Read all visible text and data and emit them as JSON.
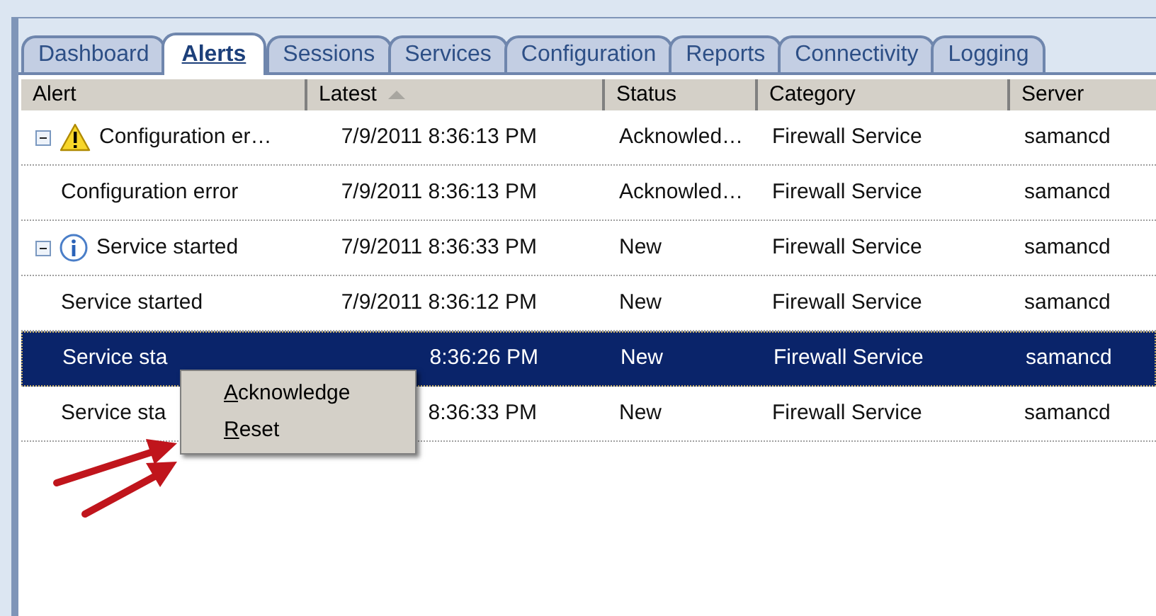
{
  "tabs": [
    {
      "label": "Dashboard",
      "selected": false
    },
    {
      "label": "Alerts",
      "selected": true
    },
    {
      "label": "Sessions",
      "selected": false
    },
    {
      "label": "Services",
      "selected": false
    },
    {
      "label": "Configuration",
      "selected": false
    },
    {
      "label": "Reports",
      "selected": false
    },
    {
      "label": "Connectivity",
      "selected": false
    },
    {
      "label": "Logging",
      "selected": false
    }
  ],
  "table": {
    "columns": [
      {
        "label": "Alert",
        "sorted": false
      },
      {
        "label": "Latest",
        "sorted": true
      },
      {
        "label": "Status",
        "sorted": false
      },
      {
        "label": "Category",
        "sorted": false
      },
      {
        "label": "Server",
        "sorted": false
      }
    ],
    "rows": [
      {
        "kind": "warning",
        "expanded": true,
        "selected": false,
        "cells": [
          "Configuration er…",
          "7/9/2011 8:36:13 PM",
          "Acknowled…",
          "Firewall Service",
          "samancd"
        ],
        "children": [
          {
            "selected": false,
            "cells": [
              "Configuration error",
              "7/9/2011 8:36:13 PM",
              "Acknowled…",
              "Firewall Service",
              "samancd"
            ]
          }
        ]
      },
      {
        "kind": "info",
        "expanded": true,
        "selected": false,
        "cells": [
          "Service started",
          "7/9/2011 8:36:33 PM",
          "New",
          "Firewall Service",
          "samancd"
        ],
        "children": [
          {
            "selected": false,
            "cells": [
              "Service started",
              "7/9/2011 8:36:12 PM",
              "New",
              "Firewall Service",
              "samancd"
            ]
          },
          {
            "selected": true,
            "cells": [
              "Service sta",
              "8:36:26 PM",
              "New",
              "Firewall Service",
              "samancd"
            ]
          },
          {
            "selected": false,
            "cells": [
              "Service sta",
              "8:36:33 PM",
              "New",
              "Firewall Service",
              "samancd"
            ]
          }
        ]
      }
    ]
  },
  "context_menu": {
    "items": [
      {
        "label": "Acknowledge",
        "mnemonic": true
      },
      {
        "label": "Reset",
        "mnemonic": true
      }
    ]
  }
}
